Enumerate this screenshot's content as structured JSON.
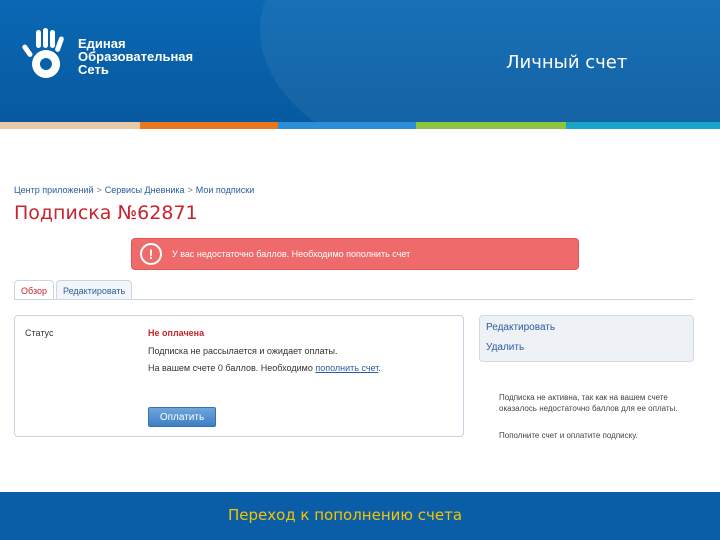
{
  "header": {
    "logo_lines": [
      "Единая",
      "Образовательная",
      "Сеть"
    ],
    "title": "Личный счет"
  },
  "colors": {
    "header_blue": "#0a67b3",
    "stripe": [
      "#e8c9a6",
      "#e87722",
      "#2a8fd8",
      "#f0b400",
      "#8cc63f",
      "#1aa3c9"
    ],
    "accent_red": "#c8242e",
    "alert_bg": "#ef6b6b",
    "link_blue": "#2a5d9f",
    "footer_caption": "#f5c400"
  },
  "breadcrumb": [
    "Центр приложений",
    "Сервисы Дневника",
    "Мои подписки"
  ],
  "breadcrumb_separator": ">",
  "page_title": "Подписка №62871",
  "alert": {
    "icon": "exclamation-icon",
    "text": "У вас недостаточно баллов. Необходимо пополнить счет"
  },
  "tabs": [
    {
      "label": "Обзор",
      "active": true
    },
    {
      "label": "Редактировать",
      "active": false
    }
  ],
  "panel": {
    "status_label": "Статус",
    "status_value": "Не оплачена",
    "status_desc": "Подписка не рассылается и ожидает оплаты.",
    "balance_text": "На вашем счете 0 баллов. Необходимо",
    "balance_link": "пополнить счет",
    "balance_suffix": ".",
    "pay_button": "Оплатить"
  },
  "side_menu": [
    "Редактировать",
    "Удалить"
  ],
  "side_note": "Подписка не активна, так как на вашем счете оказалось недостаточно баллов для ее оплаты.",
  "side_note2": "Пополните счет и оплатите подписку.",
  "footer": {
    "caption": "Переход к пополнению счета"
  }
}
